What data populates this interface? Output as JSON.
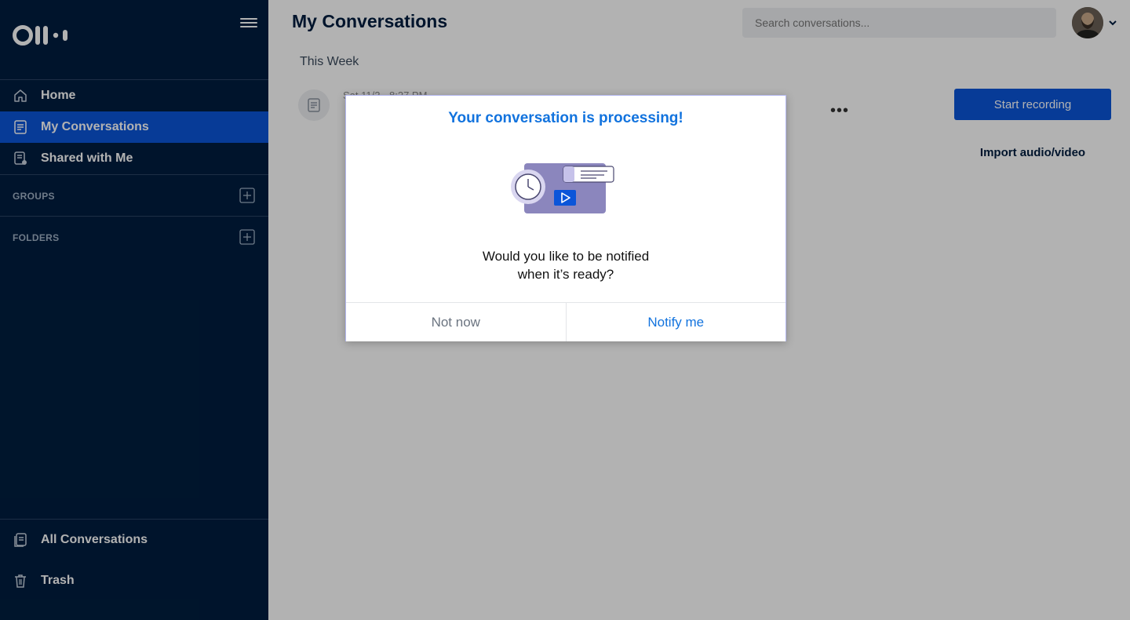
{
  "app": {
    "logo_text": "Otter"
  },
  "sidebar": {
    "nav": [
      {
        "label": "Home",
        "icon": "home-icon"
      },
      {
        "label": "My Conversations",
        "icon": "conversations-icon",
        "active": true
      },
      {
        "label": "Shared with Me",
        "icon": "shared-icon"
      }
    ],
    "groups_label": "GROUPS",
    "folders_label": "FOLDERS",
    "bottom": [
      {
        "label": "All Conversations",
        "icon": "all-conversations-icon"
      },
      {
        "label": "Trash",
        "icon": "trash-icon"
      }
    ]
  },
  "header": {
    "title": "My Conversations",
    "search_placeholder": "Search conversations..."
  },
  "main": {
    "section_label": "This Week",
    "conversation_meta": "Sat 11/2 · 8:27 PM",
    "start_recording": "Start recording",
    "import_label": "Import audio/video"
  },
  "modal": {
    "title": "Your conversation is processing!",
    "question_line1": "Would you like to be notified",
    "question_line2": "when it’s ready?",
    "cancel_label": "Not now",
    "confirm_label": "Notify me"
  },
  "colors": {
    "sidebar_bg": "#001e3f",
    "accent": "#0b55d9",
    "modal_link": "#1273de"
  }
}
